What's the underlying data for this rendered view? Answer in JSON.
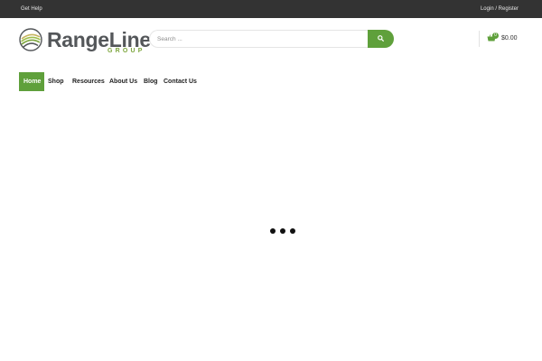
{
  "topbar": {
    "help_link": "Get Help",
    "account_link": "Login / Register"
  },
  "logo": {
    "name": "RangeLine",
    "tagline": "GROUP",
    "brand_gray": "#54575a",
    "brand_green": "#7ca53c"
  },
  "search": {
    "placeholder": "Search ...",
    "value": "",
    "button_icon": "search-icon"
  },
  "cart": {
    "icon": "basket-icon",
    "count": "0",
    "total": "$0.00"
  },
  "nav": {
    "items": [
      {
        "label": "Home",
        "active": true
      },
      {
        "label": "Shop",
        "active": false
      },
      {
        "label": "Resources",
        "active": false
      },
      {
        "label": "About Us",
        "active": false
      },
      {
        "label": "Blog",
        "active": false
      },
      {
        "label": "Contact Us",
        "active": false
      }
    ]
  },
  "loader": {
    "dots": 3
  },
  "colors": {
    "accent": "#5fa03b",
    "topbar": "#333333"
  }
}
